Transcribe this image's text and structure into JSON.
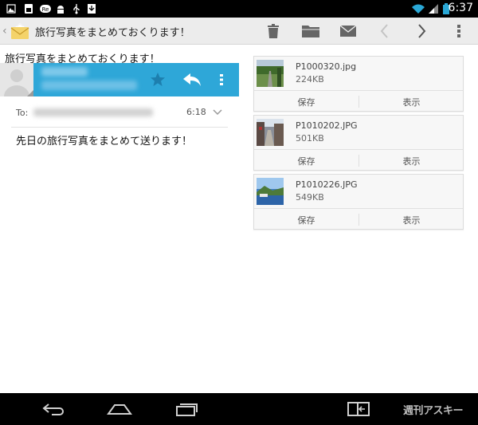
{
  "status_bar": {
    "time": "6:37",
    "icons": [
      "gallery-icon",
      "sim-icon",
      "recorder-icon",
      "android-icon",
      "usb-icon",
      "download-icon",
      "wifi-icon",
      "signal-icon",
      "battery-icon"
    ]
  },
  "action_bar": {
    "title": "旅行写真をまとめておくります！",
    "actions": [
      "trash-icon",
      "folder-icon",
      "envelope-icon",
      "chevron-left-icon",
      "chevron-right-icon",
      "overflow-icon"
    ]
  },
  "message": {
    "subject": "旅行写真をまとめておくります！",
    "to_label": "To:",
    "time": "6:18",
    "body": "先日の旅行写真をまとめて送ります！"
  },
  "attachments": [
    {
      "filename": "P1000320.jpg",
      "size": "224KB",
      "save_label": "保存",
      "view_label": "表示"
    },
    {
      "filename": "P1010202.JPG",
      "size": "501KB",
      "save_label": "保存",
      "view_label": "表示"
    },
    {
      "filename": "P1010226.JPG",
      "size": "549KB",
      "save_label": "保存",
      "view_label": "表示"
    }
  ],
  "nav_bar": {
    "watermark": "週刊アスキー"
  },
  "colors": {
    "accent": "#2ea7d8",
    "status_bar": "#000000",
    "action_bar": "#ececec",
    "status_icon": "#2aa8d6"
  }
}
